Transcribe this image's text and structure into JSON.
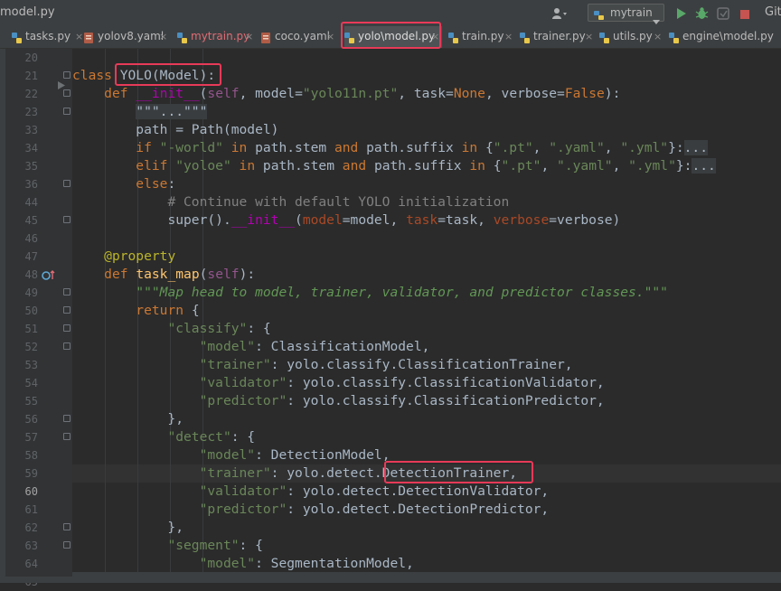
{
  "window": {
    "file_title": "model.py",
    "git_label": "Git:"
  },
  "run_config": {
    "label": "mytrain"
  },
  "toolbar_icons": [
    "user-icon",
    "run-icon",
    "debug-icon",
    "coverage-icon",
    "stop-icon"
  ],
  "tabs": [
    {
      "label": "tasks.py",
      "icon": "python-file-icon"
    },
    {
      "label": "yolov8.yaml",
      "icon": "yaml-file-icon"
    },
    {
      "label": "mytrain.py",
      "icon": "python-file-icon"
    },
    {
      "label": "coco.yaml",
      "icon": "yaml-file-icon"
    },
    {
      "label": "yolo\\model.py",
      "icon": "python-file-icon"
    },
    {
      "label": "train.py",
      "icon": "python-file-icon"
    },
    {
      "label": "trainer.py",
      "icon": "python-file-icon"
    },
    {
      "label": "utils.py",
      "icon": "python-file-icon"
    },
    {
      "label": "engine\\model.py",
      "icon": "python-file-icon"
    }
  ],
  "active_tab": "yolo\\model.py",
  "line_numbers": [
    "20",
    "21",
    "22",
    "23",
    "33",
    "34",
    "35",
    "36",
    "44",
    "45",
    "46",
    "47",
    "48",
    "49",
    "50",
    "51",
    "52",
    "53",
    "54",
    "55",
    "56",
    "57",
    "58",
    "59",
    "60",
    "61",
    "62",
    "63",
    "64",
    "65"
  ],
  "current_line": "60",
  "code": [
    [],
    [
      [
        "kw",
        "class "
      ],
      [
        "plain",
        "YOLO(Model):"
      ]
    ],
    [
      [
        "plain",
        "    "
      ],
      [
        "kw",
        "def "
      ],
      [
        "dunder",
        "__init__"
      ],
      [
        "plain",
        "("
      ],
      [
        "self",
        "self"
      ],
      [
        "plain",
        ", model="
      ],
      [
        "str",
        "\"yolo11n.pt\""
      ],
      [
        "plain",
        ", task="
      ],
      [
        "kw",
        "None"
      ],
      [
        "plain",
        ", verbose="
      ],
      [
        "kw",
        "False"
      ],
      [
        "plain",
        "):"
      ]
    ],
    [
      [
        "plain",
        "        "
      ],
      [
        "fold",
        "\"\"\"...\"\"\""
      ]
    ],
    [
      [
        "plain",
        "        path = Path(model)"
      ]
    ],
    [
      [
        "plain",
        "        "
      ],
      [
        "kw",
        "if "
      ],
      [
        "str",
        "\"-world\""
      ],
      [
        "kw",
        " in "
      ],
      [
        "plain",
        "path.stem "
      ],
      [
        "kw",
        "and "
      ],
      [
        "plain",
        "path.suffix "
      ],
      [
        "kw",
        "in "
      ],
      [
        "plain",
        "{"
      ],
      [
        "str",
        "\".pt\""
      ],
      [
        "plain",
        ", "
      ],
      [
        "str",
        "\".yaml\""
      ],
      [
        "plain",
        ", "
      ],
      [
        "str",
        "\".yml\""
      ],
      [
        "plain",
        "}:"
      ],
      [
        "fold",
        "..."
      ]
    ],
    [
      [
        "plain",
        "        "
      ],
      [
        "kw",
        "elif "
      ],
      [
        "str",
        "\"yoloe\""
      ],
      [
        "kw",
        " in "
      ],
      [
        "plain",
        "path.stem "
      ],
      [
        "kw",
        "and "
      ],
      [
        "plain",
        "path.suffix "
      ],
      [
        "kw",
        "in "
      ],
      [
        "plain",
        "{"
      ],
      [
        "str",
        "\".pt\""
      ],
      [
        "plain",
        ", "
      ],
      [
        "str",
        "\".yaml\""
      ],
      [
        "plain",
        ", "
      ],
      [
        "str",
        "\".yml\""
      ],
      [
        "plain",
        "}:"
      ],
      [
        "fold",
        "..."
      ]
    ],
    [
      [
        "plain",
        "        "
      ],
      [
        "kw",
        "else"
      ],
      [
        "plain",
        ":"
      ]
    ],
    [
      [
        "plain",
        "            "
      ],
      [
        "cmt",
        "# Continue with default YOLO initialization"
      ]
    ],
    [
      [
        "plain",
        "            "
      ],
      [
        "plain",
        "super()."
      ],
      [
        "dunder",
        "__init__"
      ],
      [
        "plain",
        "("
      ],
      [
        "param",
        "model"
      ],
      [
        "plain",
        "=model, "
      ],
      [
        "param",
        "task"
      ],
      [
        "plain",
        "=task, "
      ],
      [
        "param",
        "verbose"
      ],
      [
        "plain",
        "=verbose)"
      ]
    ],
    [],
    [
      [
        "plain",
        "    "
      ],
      [
        "deco",
        "@property"
      ]
    ],
    [
      [
        "plain",
        "    "
      ],
      [
        "kw",
        "def "
      ],
      [
        "fn",
        "task_map"
      ],
      [
        "plain",
        "("
      ],
      [
        "self",
        "self"
      ],
      [
        "plain",
        "):"
      ]
    ],
    [
      [
        "plain",
        "        "
      ],
      [
        "doc",
        "\"\"\"Map head to model, trainer, validator, and predictor classes.\"\"\""
      ]
    ],
    [
      [
        "plain",
        "        "
      ],
      [
        "kw",
        "return "
      ],
      [
        "plain",
        "{"
      ]
    ],
    [
      [
        "plain",
        "            "
      ],
      [
        "str",
        "\"classify\""
      ],
      [
        "plain",
        ": {"
      ]
    ],
    [
      [
        "plain",
        "                "
      ],
      [
        "str",
        "\"model\""
      ],
      [
        "plain",
        ": ClassificationModel,"
      ]
    ],
    [
      [
        "plain",
        "                "
      ],
      [
        "str",
        "\"trainer\""
      ],
      [
        "plain",
        ": yolo.classify.ClassificationTrainer,"
      ]
    ],
    [
      [
        "plain",
        "                "
      ],
      [
        "str",
        "\"validator\""
      ],
      [
        "plain",
        ": yolo.classify.ClassificationValidator,"
      ]
    ],
    [
      [
        "plain",
        "                "
      ],
      [
        "str",
        "\"predictor\""
      ],
      [
        "plain",
        ": yolo.classify.ClassificationPredictor,"
      ]
    ],
    [
      [
        "plain",
        "            },"
      ]
    ],
    [
      [
        "plain",
        "            "
      ],
      [
        "str",
        "\"detect\""
      ],
      [
        "plain",
        ": {"
      ]
    ],
    [
      [
        "plain",
        "                "
      ],
      [
        "str",
        "\"model\""
      ],
      [
        "plain",
        ": DetectionModel,"
      ]
    ],
    [
      [
        "plain",
        "                "
      ],
      [
        "str",
        "\"trainer\""
      ],
      [
        "plain",
        ": yolo.detect.DetectionTrainer,"
      ]
    ],
    [
      [
        "plain",
        "                "
      ],
      [
        "str",
        "\"validator\""
      ],
      [
        "plain",
        ": yolo.detect.DetectionValidator,"
      ]
    ],
    [
      [
        "plain",
        "                "
      ],
      [
        "str",
        "\"predictor\""
      ],
      [
        "plain",
        ": yolo.detect.DetectionPredictor,"
      ]
    ],
    [
      [
        "plain",
        "            },"
      ]
    ],
    [
      [
        "plain",
        "            "
      ],
      [
        "str",
        "\"segment\""
      ],
      [
        "plain",
        ": {"
      ]
    ],
    [
      [
        "plain",
        "                "
      ],
      [
        "str",
        "\"model\""
      ],
      [
        "plain",
        ": SegmentationModel,"
      ]
    ]
  ]
}
